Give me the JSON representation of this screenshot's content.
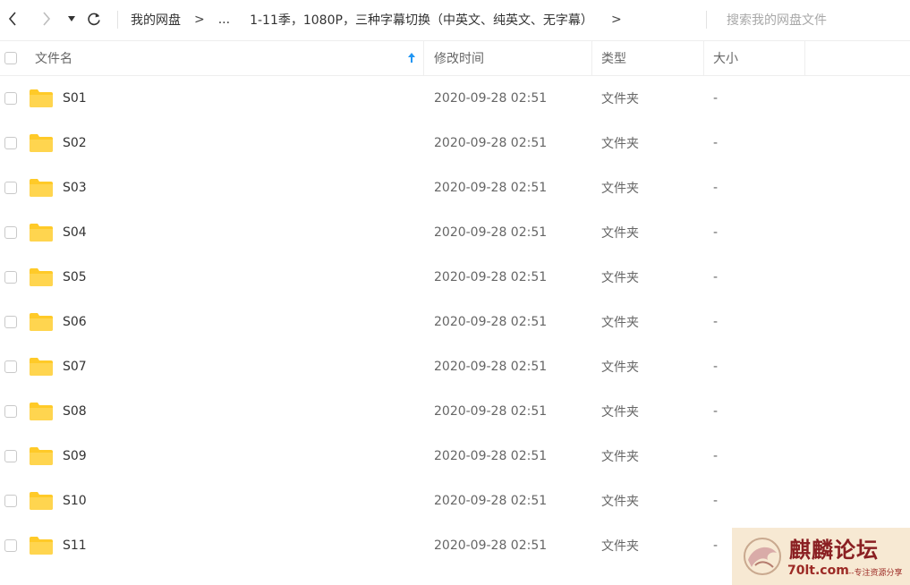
{
  "toolbar": {
    "back": "back",
    "forward": "forward",
    "dropdown": "history",
    "refresh": "refresh"
  },
  "breadcrumb": {
    "root": "我的网盘",
    "separator": ">",
    "ellipsis": "...",
    "current": "1-11季，1080P，三种字幕切换（中英文、纯英文、无字幕）"
  },
  "search": {
    "placeholder": "搜索我的网盘文件"
  },
  "columns": {
    "name": "文件名",
    "modified": "修改时间",
    "type": "类型",
    "size": "大小"
  },
  "files": [
    {
      "name": "S01",
      "modified": "2020-09-28 02:51",
      "type": "文件夹",
      "size": "-"
    },
    {
      "name": "S02",
      "modified": "2020-09-28 02:51",
      "type": "文件夹",
      "size": "-"
    },
    {
      "name": "S03",
      "modified": "2020-09-28 02:51",
      "type": "文件夹",
      "size": "-"
    },
    {
      "name": "S04",
      "modified": "2020-09-28 02:51",
      "type": "文件夹",
      "size": "-"
    },
    {
      "name": "S05",
      "modified": "2020-09-28 02:51",
      "type": "文件夹",
      "size": "-"
    },
    {
      "name": "S06",
      "modified": "2020-09-28 02:51",
      "type": "文件夹",
      "size": "-"
    },
    {
      "name": "S07",
      "modified": "2020-09-28 02:51",
      "type": "文件夹",
      "size": "-"
    },
    {
      "name": "S08",
      "modified": "2020-09-28 02:51",
      "type": "文件夹",
      "size": "-"
    },
    {
      "name": "S09",
      "modified": "2020-09-28 02:51",
      "type": "文件夹",
      "size": "-"
    },
    {
      "name": "S10",
      "modified": "2020-09-28 02:51",
      "type": "文件夹",
      "size": "-"
    },
    {
      "name": "S11",
      "modified": "2020-09-28 02:51",
      "type": "文件夹",
      "size": "-"
    }
  ],
  "watermark": {
    "title": "麒麟论坛",
    "site": "70lt.com",
    "slogan": "--专注资源分享"
  },
  "colors": {
    "folder": "#ffca28",
    "sort_arrow": "#2196f3",
    "watermark_bg": "#f7e9d3",
    "watermark_text": "#8a1f22"
  }
}
